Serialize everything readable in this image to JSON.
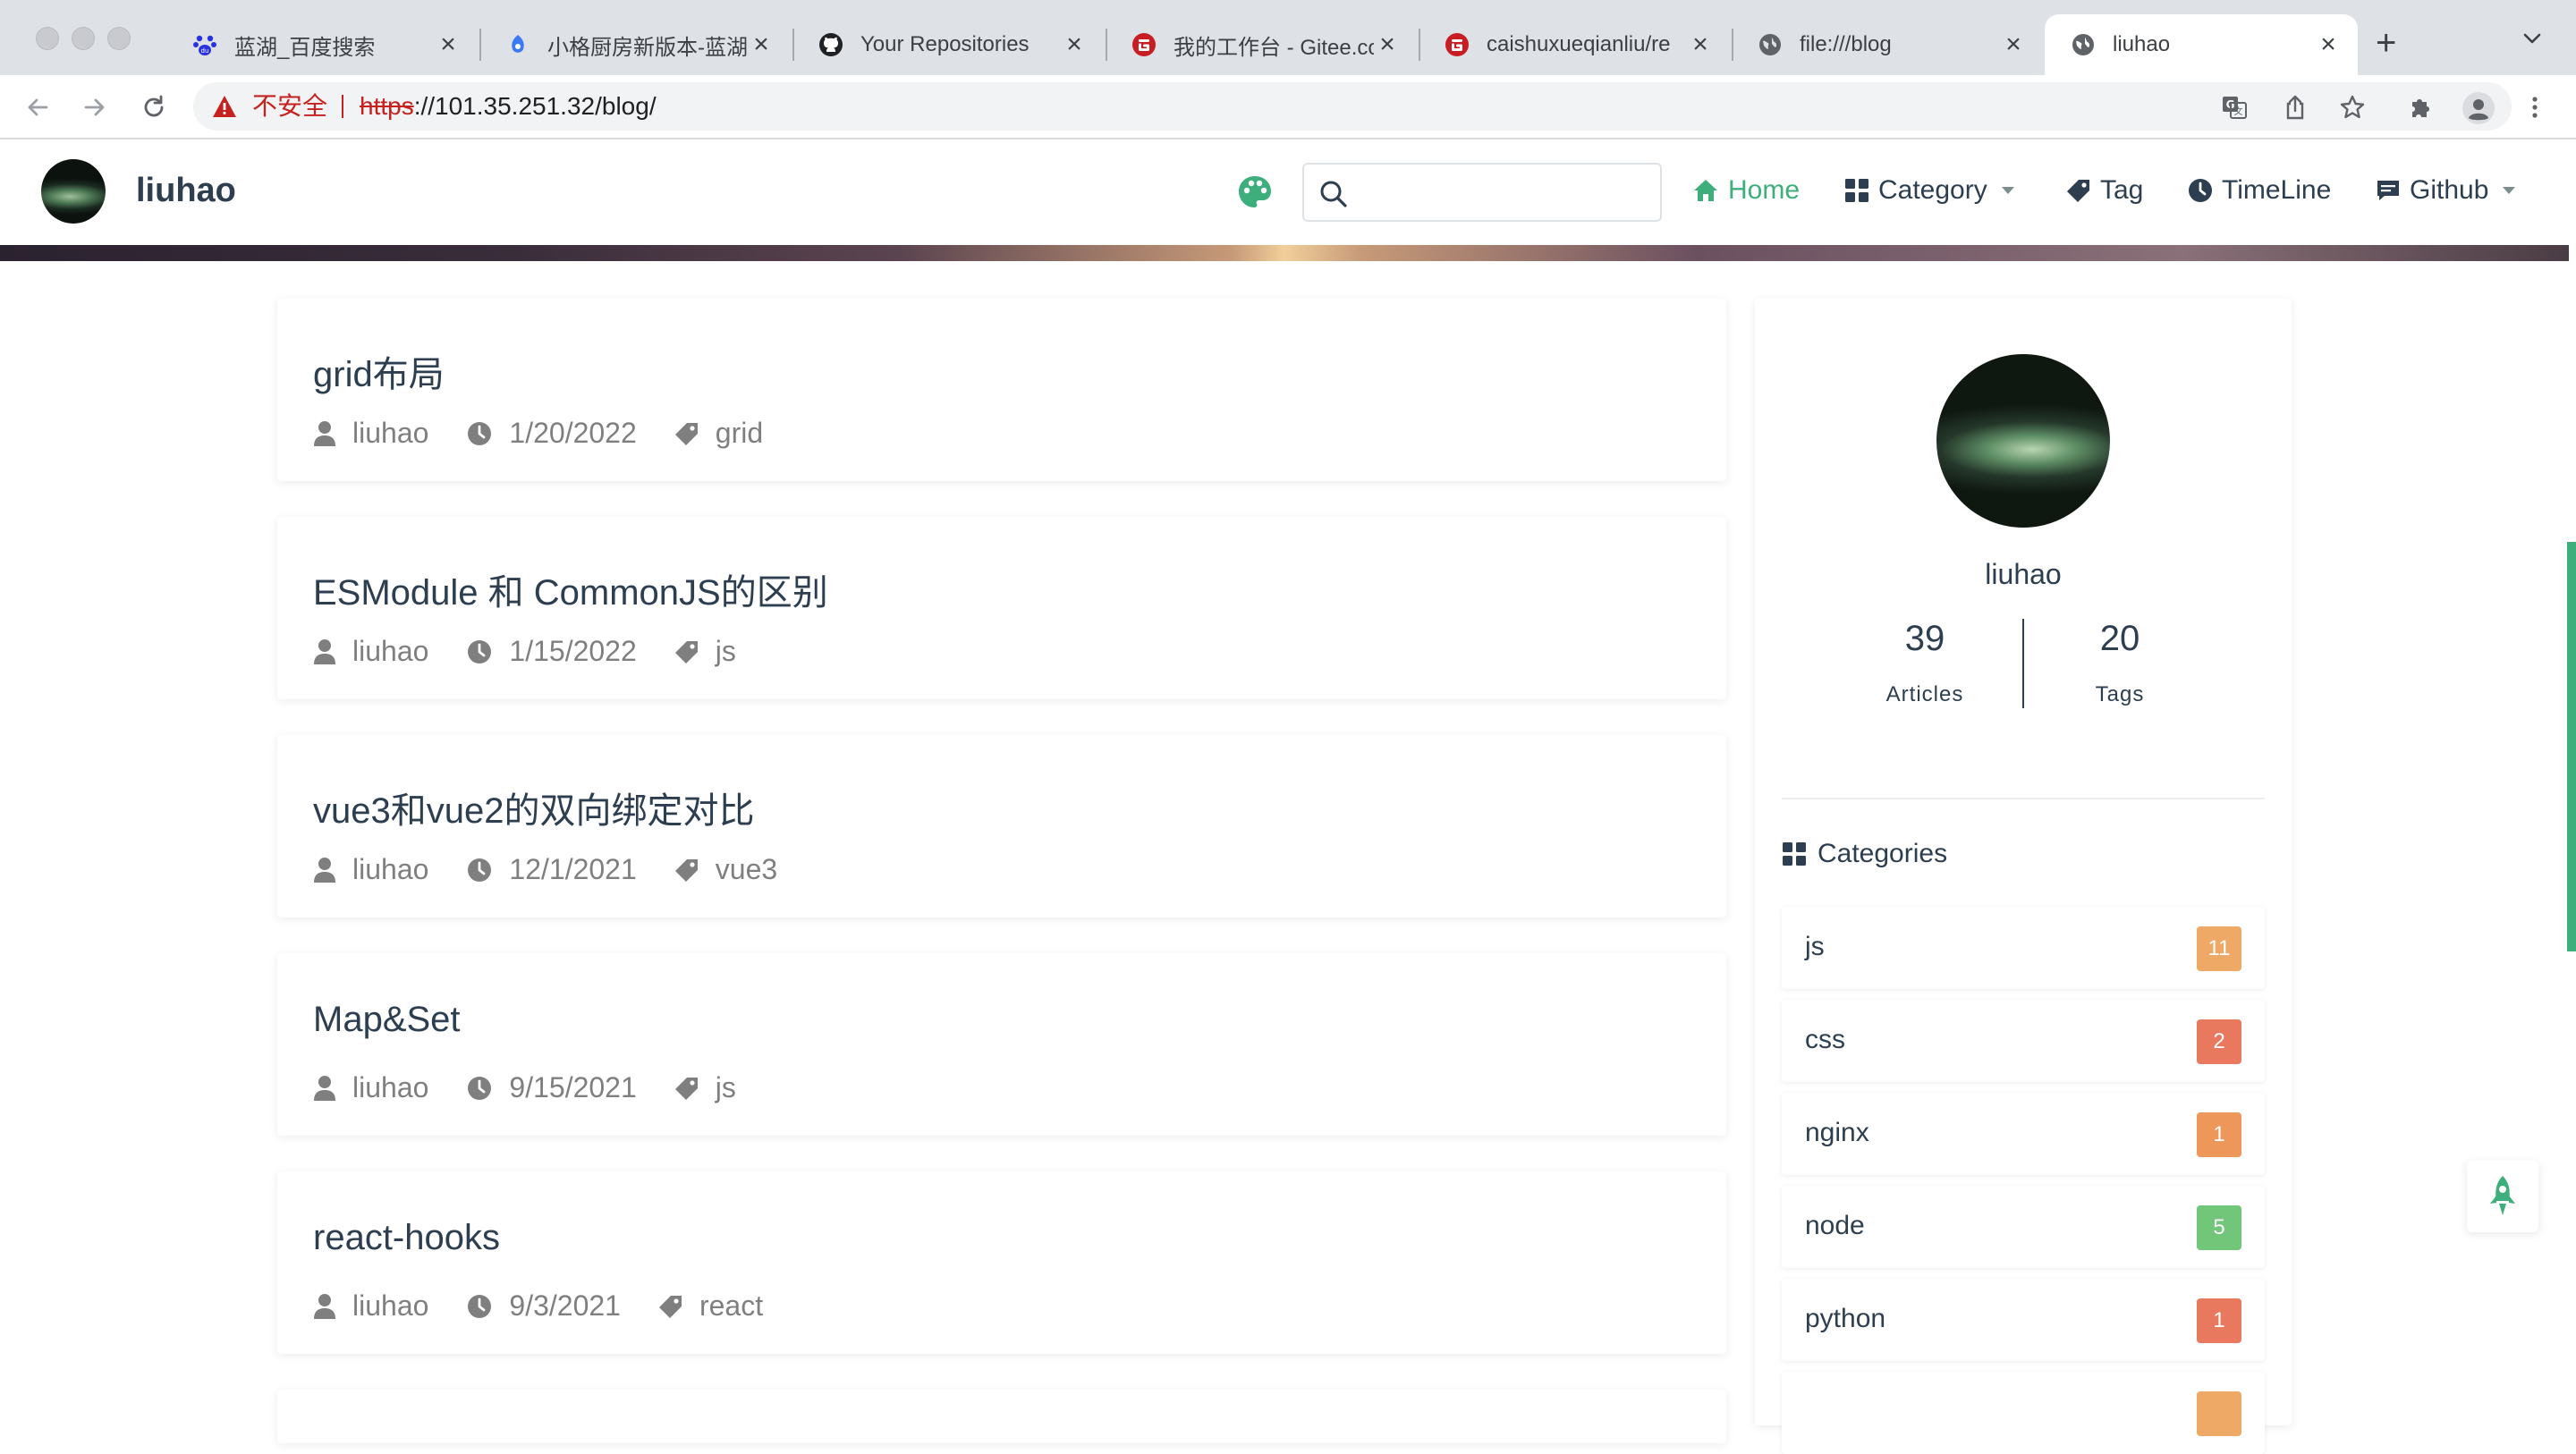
{
  "browser": {
    "tabs": [
      {
        "title": "蓝湖_百度搜索",
        "icon": "baidu-paw-icon"
      },
      {
        "title": "小格厨房新版本-蓝湖",
        "icon": "lanhu-icon"
      },
      {
        "title": "Your Repositories",
        "icon": "github-icon"
      },
      {
        "title": "我的工作台 - Gitee.com",
        "icon": "gitee-icon"
      },
      {
        "title": "caishuxueqianliu/re",
        "icon": "gitee-icon"
      },
      {
        "title": "file:///blog",
        "icon": "globe-icon"
      },
      {
        "title": "liuhao",
        "icon": "globe-icon",
        "active": true
      }
    ],
    "address": {
      "security_label": "不安全",
      "scheme": "https",
      "rest": "://101.35.251.32/blog/"
    }
  },
  "site": {
    "title": "liuhao",
    "search": {
      "placeholder": ""
    },
    "nav": {
      "home": "Home",
      "category": "Category",
      "tag": "Tag",
      "timeline": "TimeLine",
      "github": "Github"
    },
    "accent": "#3eaf7c"
  },
  "articles": [
    {
      "title": "grid布局",
      "author": "liuhao",
      "date": "1/20/2022",
      "tag": "grid"
    },
    {
      "title": "ESModule 和 CommonJS的区别",
      "author": "liuhao",
      "date": "1/15/2022",
      "tag": "js"
    },
    {
      "title": "vue3和vue2的双向绑定对比",
      "author": "liuhao",
      "date": "12/1/2021",
      "tag": "vue3"
    },
    {
      "title": "Map&Set",
      "author": "liuhao",
      "date": "9/15/2021",
      "tag": "js"
    },
    {
      "title": "react-hooks",
      "author": "liuhao",
      "date": "9/3/2021",
      "tag": "react"
    }
  ],
  "sidebar": {
    "name": "liuhao",
    "articles_count": "39",
    "articles_label": "Articles",
    "tags_count": "20",
    "tags_label": "Tags",
    "categories_heading": "Categories",
    "categories": [
      {
        "name": "js",
        "count": "11",
        "color": "#efa966"
      },
      {
        "name": "css",
        "count": "2",
        "color": "#e8795f"
      },
      {
        "name": "nginx",
        "count": "1",
        "color": "#ee975a"
      },
      {
        "name": "node",
        "count": "5",
        "color": "#71c67a"
      },
      {
        "name": "python",
        "count": "1",
        "color": "#e8795f"
      }
    ]
  }
}
